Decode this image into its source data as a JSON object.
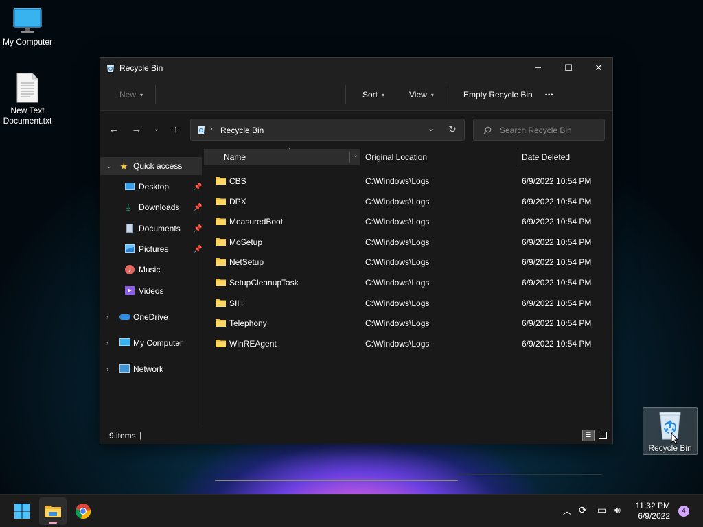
{
  "desktop": {
    "icons": [
      {
        "label": "My Computer"
      },
      {
        "label": "New Text Document.txt"
      },
      {
        "label": "Recycle Bin"
      }
    ]
  },
  "window": {
    "title": "Recycle Bin",
    "controls": {
      "minimize": "─",
      "maximize": "☐",
      "close": "✕"
    },
    "toolbar": {
      "new_label": "New",
      "sort_label": "Sort",
      "view_label": "View",
      "empty_label": "Empty Recycle Bin",
      "more_label": "•••"
    },
    "address": {
      "path": "Recycle Bin"
    },
    "search": {
      "placeholder": "Search Recycle Bin"
    },
    "sidebar": {
      "items": [
        {
          "label": "Quick access",
          "icon": "star-icon"
        },
        {
          "label": "Desktop",
          "icon": "desktop-icon"
        },
        {
          "label": "Downloads",
          "icon": "download-icon"
        },
        {
          "label": "Documents",
          "icon": "document-icon"
        },
        {
          "label": "Pictures",
          "icon": "pictures-icon"
        },
        {
          "label": "Music",
          "icon": "music-icon"
        },
        {
          "label": "Videos",
          "icon": "videos-icon"
        },
        {
          "label": "OneDrive",
          "icon": "cloud-icon"
        },
        {
          "label": "My Computer",
          "icon": "computer-icon"
        },
        {
          "label": "Network",
          "icon": "network-icon"
        }
      ]
    },
    "columns": {
      "name": "Name",
      "location": "Original Location",
      "date": "Date Deleted"
    },
    "rows": [
      {
        "name": "CBS",
        "location": "C:\\Windows\\Logs",
        "date": "6/9/2022 10:54 PM"
      },
      {
        "name": "DPX",
        "location": "C:\\Windows\\Logs",
        "date": "6/9/2022 10:54 PM"
      },
      {
        "name": "MeasuredBoot",
        "location": "C:\\Windows\\Logs",
        "date": "6/9/2022 10:54 PM"
      },
      {
        "name": "MoSetup",
        "location": "C:\\Windows\\Logs",
        "date": "6/9/2022 10:54 PM"
      },
      {
        "name": "NetSetup",
        "location": "C:\\Windows\\Logs",
        "date": "6/9/2022 10:54 PM"
      },
      {
        "name": "SetupCleanupTask",
        "location": "C:\\Windows\\Logs",
        "date": "6/9/2022 10:54 PM"
      },
      {
        "name": "SIH",
        "location": "C:\\Windows\\Logs",
        "date": "6/9/2022 10:54 PM"
      },
      {
        "name": "Telephony",
        "location": "C:\\Windows\\Logs",
        "date": "6/9/2022 10:54 PM"
      },
      {
        "name": "WinREAgent",
        "location": "C:\\Windows\\Logs",
        "date": "6/9/2022 10:54 PM"
      }
    ],
    "status": {
      "count": "9 items"
    }
  },
  "taskbar": {
    "clock_time": "11:32 PM",
    "clock_date": "6/9/2022",
    "notification_count": "4"
  },
  "colors": {
    "accent": "#4cc2ff",
    "folder": "#f0c44b",
    "window_bg": "#191919"
  }
}
